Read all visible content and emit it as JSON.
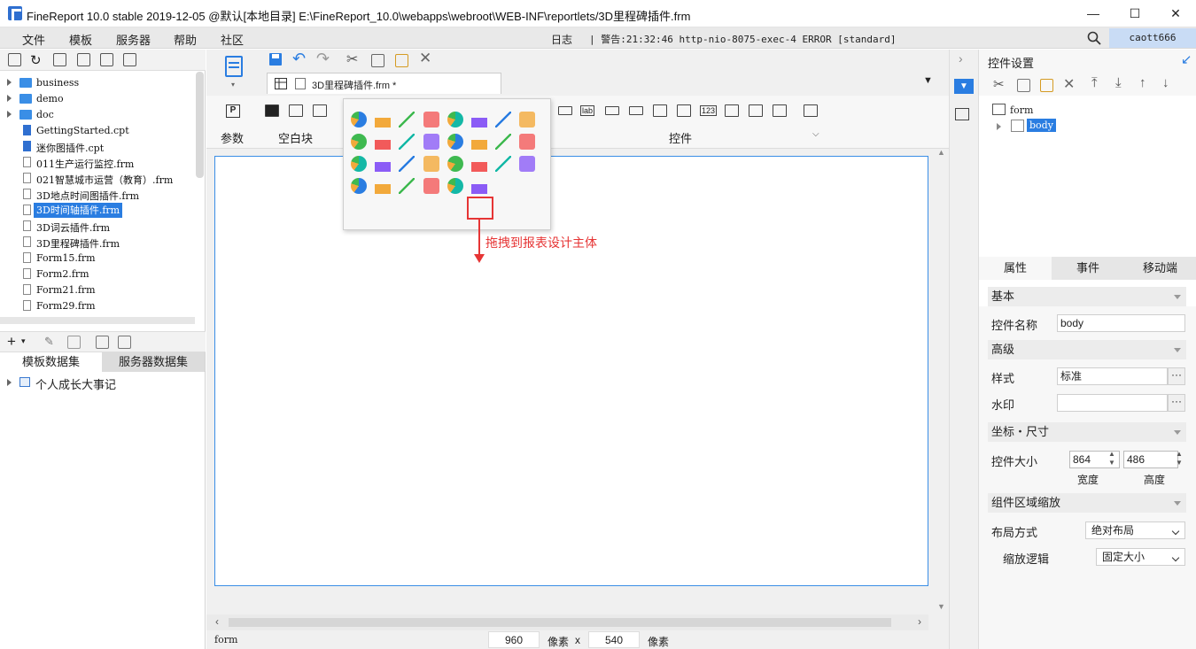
{
  "window": {
    "title": "FineReport 10.0 stable 2019-12-05 @默认[本地目录]    E:\\FineReport_10.0\\webapps\\webroot\\WEB-INF\\reportlets/3D里程碑插件.frm",
    "minimize": "—",
    "maximize": "☐",
    "close": "✕"
  },
  "menu": {
    "items": [
      "文件",
      "模板",
      "服务器",
      "帮助",
      "社区"
    ],
    "log": "日志",
    "warning": "| 警告:21:32:46 http-nio-8075-exec-4 ERROR [standard]",
    "user": "caott666"
  },
  "file_tree": {
    "items": [
      {
        "label": "business",
        "type": "folder"
      },
      {
        "label": "demo",
        "type": "folder"
      },
      {
        "label": "doc",
        "type": "folder"
      },
      {
        "label": "GettingStarted.cpt",
        "type": "cpt"
      },
      {
        "label": "迷你图插件.cpt",
        "type": "cpt"
      },
      {
        "label": "011生产运行监控.frm",
        "type": "frm"
      },
      {
        "label": "021智慧城市运营（教育）.frm",
        "type": "frm"
      },
      {
        "label": "3D地点时间图插件.frm",
        "type": "frm"
      },
      {
        "label": "3D时间轴插件.frm",
        "type": "frm",
        "selected": true
      },
      {
        "label": "3D词云插件.frm",
        "type": "frm"
      },
      {
        "label": "3D里程碑插件.frm",
        "type": "frm"
      },
      {
        "label": "Form15.frm",
        "type": "frm"
      },
      {
        "label": "Form2.frm",
        "type": "frm"
      },
      {
        "label": "Form21.frm",
        "type": "frm"
      },
      {
        "label": "Form29.frm",
        "type": "frm"
      }
    ]
  },
  "datasets": {
    "tabs": [
      "模板数据集",
      "服务器数据集"
    ],
    "items": [
      "个人成长大事记"
    ]
  },
  "editor": {
    "tab_label": "3D里程碑插件.frm *",
    "ribbon": {
      "params": "参数",
      "blank": "空白块",
      "controls": "控件",
      "lab": "lab",
      "num": "123"
    },
    "annotation": "拖拽到报表设计主体",
    "status": {
      "form": "form",
      "width": "960",
      "px1": "像素",
      "x": "x",
      "height": "540",
      "px2": "像素"
    }
  },
  "right_panel": {
    "title": "控件设置",
    "tree": {
      "root": "form",
      "child": "body"
    },
    "tabs": [
      "属性",
      "事件",
      "移动端"
    ],
    "sections": {
      "basic": "基本",
      "advanced": "高级",
      "coords": "坐标・尺寸",
      "scaling": "组件区域缩放"
    },
    "fields": {
      "name_label": "控件名称",
      "name_value": "body",
      "style_label": "样式",
      "style_value": "标准",
      "watermark_label": "水印",
      "watermark_value": "",
      "size_label": "控件大小",
      "width_value": "864",
      "height_value": "486",
      "width_caption": "宽度",
      "height_caption": "高度",
      "layout_label": "布局方式",
      "layout_value": "绝对布局",
      "scale_label": "缩放逻辑",
      "scale_value": "固定大小",
      "ellipsis": "···"
    }
  },
  "colors": {
    "accent": "#2a7de1",
    "annotation": "#e63535"
  }
}
